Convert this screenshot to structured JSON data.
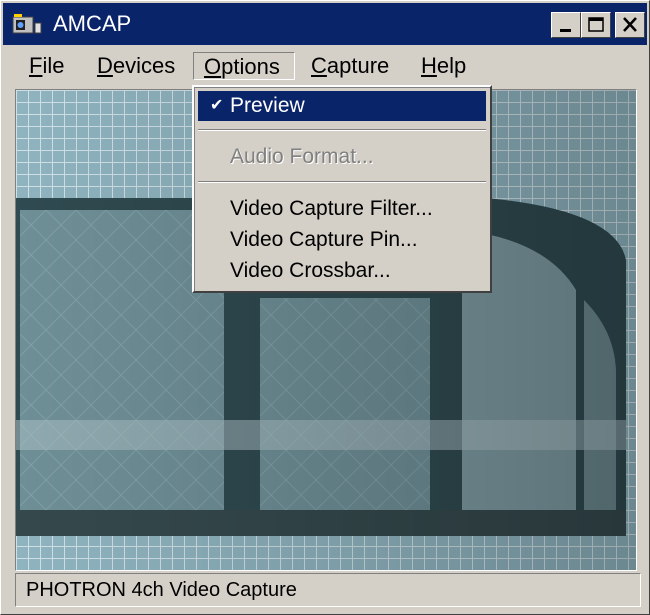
{
  "window": {
    "title": "AMCAP",
    "controls": {
      "minimize_icon": "minimize-icon",
      "maximize_icon": "maximize-icon",
      "close_icon": "close-icon"
    }
  },
  "menubar": {
    "file": {
      "first": "F",
      "rest": "ile"
    },
    "devices": {
      "first": "D",
      "rest": "evices"
    },
    "options": {
      "first": "O",
      "rest": "ptions"
    },
    "capture": {
      "first": "C",
      "rest": "apture"
    },
    "help": {
      "first": "H",
      "rest": "elp"
    }
  },
  "options_menu": {
    "preview": "Preview",
    "preview_checked": true,
    "audio_format": "Audio Format...",
    "video_capture_filter": "Video Capture Filter...",
    "video_capture_pin": "Video Capture Pin...",
    "video_crossbar": "Video Crossbar..."
  },
  "status": {
    "text": "PHOTRON 4ch Video Capture"
  },
  "colors": {
    "titlebar": "#0a246a",
    "face": "#d4d0c8",
    "highlight": "#0a246a"
  }
}
